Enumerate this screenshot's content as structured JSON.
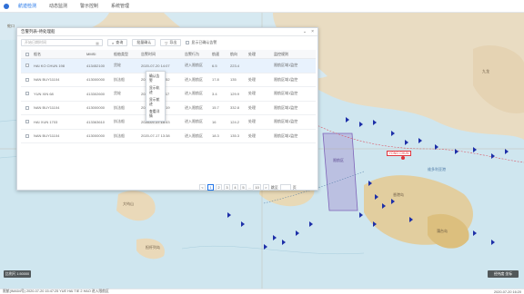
{
  "nav": {
    "items": [
      {
        "label": "航迹检测",
        "active": true
      },
      {
        "label": "动态监测",
        "active": false
      },
      {
        "label": "警示控制",
        "active": false
      },
      {
        "label": "系统管理",
        "active": false
      }
    ]
  },
  "panel": {
    "title": "告警列表-待处理船",
    "toolbar": {
      "date_placeholder": "开始日期时间",
      "search_label": "查询",
      "batch_label": "批量确认",
      "export_label": "导出",
      "only_unconfirmed_label": "显示已确认告警"
    },
    "table": {
      "headers": [
        "船名",
        "MMSI",
        "船舶类型",
        "告警时间",
        "告警行为",
        "航速",
        "航向",
        "处理",
        "监控规则"
      ],
      "rows": [
        {
          "name": "HAI KO CHUN 198",
          "mmsi": "413452100",
          "type": "货轮",
          "time": "2020-07-20 14:07",
          "behavior": "进入限航区",
          "speed": "6.5",
          "course": "223.4",
          "status": "",
          "rule": "限航区域1监控",
          "selected": true
        },
        {
          "name": "NAN BUY11104",
          "mmsi": "413000000",
          "type": "执法船",
          "time": "2020-07-20 13:52",
          "behavior": "进入限航区",
          "speed": "17.8",
          "course": "135",
          "status": "处理",
          "rule": "限航区域1监控",
          "selected": false
        },
        {
          "name": "YUN XIN 68",
          "mmsi": "413302600",
          "type": "货轮",
          "time": "2020-07-20 11:17",
          "behavior": "进入限航区",
          "speed": "3.4",
          "course": "129.9",
          "status": "处理",
          "rule": "限航区域1监控",
          "selected": false
        },
        {
          "name": "NAN BUY11104",
          "mmsi": "413000000",
          "type": "执法船",
          "time": "2020-07-20 00:19",
          "behavior": "进入限航区",
          "speed": "15.7",
          "course": "332.8",
          "status": "处理",
          "rule": "限航区域1监控",
          "selected": false
        },
        {
          "name": "HAI XUN 1703",
          "mmsi": "413363610",
          "type": "执法船",
          "time": "2020-07-17 15:43",
          "behavior": "进入限航区",
          "speed": "16",
          "course": "124.2",
          "status": "处理",
          "rule": "限航区域1监控",
          "selected": false
        },
        {
          "name": "NAN BUY11104",
          "mmsi": "413000000",
          "type": "执法船",
          "time": "2020-07-17 13:38",
          "behavior": "进入限航区",
          "speed": "18.3",
          "course": "135.3",
          "status": "处理",
          "rule": "限航区域1监控",
          "selected": false
        }
      ]
    },
    "context_menu": [
      "确认告警",
      "显示轨迹",
      "显示航迹",
      "查看详情"
    ],
    "pagination": {
      "prev": "<",
      "pages": [
        "1",
        "2",
        "3",
        "4",
        "5",
        "...",
        "10"
      ],
      "active": "1",
      "next": ">",
      "goto_label": "跳至",
      "page_unit": "页"
    }
  },
  "map": {
    "labels": [
      {
        "text": "蛇口",
        "kind": "land"
      },
      {
        "text": "伶仃洋",
        "kind": "sea"
      },
      {
        "text": "珠江口",
        "kind": "sea"
      },
      {
        "text": "大屿山",
        "kind": "land"
      },
      {
        "text": "香港岛",
        "kind": "land"
      },
      {
        "text": "维多利亚港",
        "kind": "sea"
      },
      {
        "text": "南丫岛",
        "kind": "land"
      },
      {
        "text": "蒲台岛",
        "kind": "land"
      },
      {
        "text": "担杆列岛",
        "kind": "land"
      },
      {
        "text": "九龙",
        "kind": "land"
      },
      {
        "text": "赤湾",
        "kind": "land"
      }
    ],
    "alert_tag": "YONG CHUN",
    "restricted_zone_label": "限航区",
    "scale_left": "比例尺 1:50000",
    "scale_right": "经纬度 坐标"
  },
  "statusbar": {
    "left": "限航(IMA54号) 2020-07-20 15:47:25 YUE HAI TIE 2 HAO 进入限航区",
    "right": "2020-07-20 16:20"
  },
  "colors": {
    "accent": "#1e73e8",
    "sea": "#cfe6ef",
    "land": "#e9dcc2",
    "ship": "#1d2fa8",
    "alert": "#e0343c"
  }
}
